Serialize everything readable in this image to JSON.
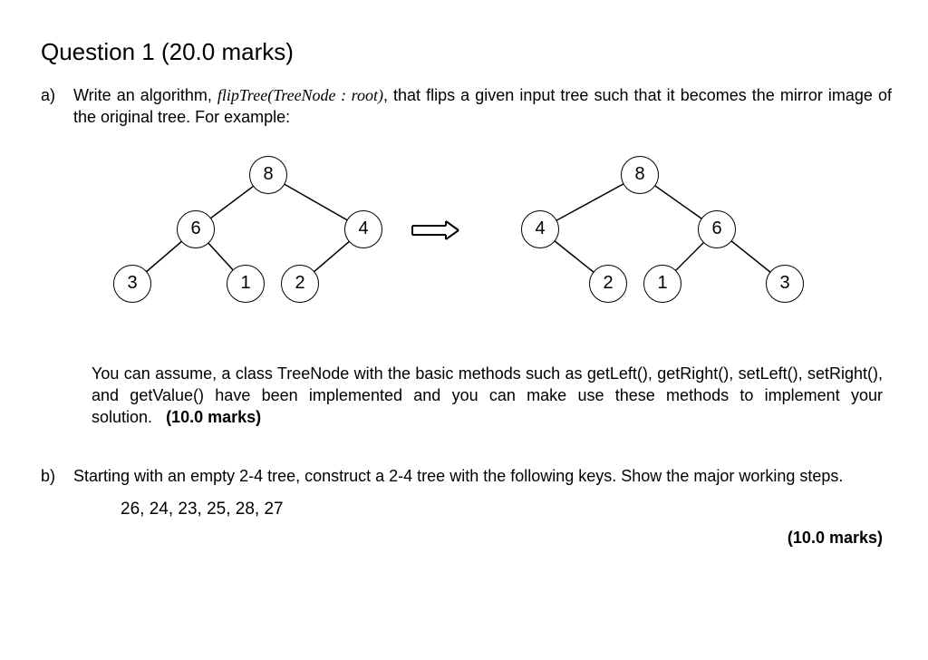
{
  "title": "Question 1 (20.0 marks)",
  "partA": {
    "letter": "a)",
    "lead": "Write an algorithm, ",
    "func": "flipTree(TreeNode : root)",
    "tail1": ", that flips a given input tree such that it becomes the mirror image of the original tree. For example:",
    "assume1": "You can assume, a class TreeNode with the basic methods such as getLeft(), getRight(), setLeft(), setRight(), and getValue() have been implemented and you can make use these methods to implement your solution.",
    "marksInline": "(10.0 marks)"
  },
  "tree_left": {
    "n8": "8",
    "n6": "6",
    "n4": "4",
    "n3": "3",
    "n1": "1",
    "n2": "2"
  },
  "tree_right": {
    "n8": "8",
    "n4": "4",
    "n6": "6",
    "n2": "2",
    "n1": "1",
    "n3": "3"
  },
  "partB": {
    "letter": "b)",
    "text": "Starting with an empty 2-4 tree, construct a 2-4 tree with the following keys. Show the major working steps.",
    "keys": "26, 24, 23, 25, 28, 27",
    "marks": "(10.0 marks)"
  },
  "chart_data": [
    {
      "type": "tree",
      "title": "original",
      "nodes": [
        {
          "id": "8",
          "children": [
            "6",
            "4"
          ]
        },
        {
          "id": "6",
          "children": [
            "3",
            "1"
          ]
        },
        {
          "id": "4",
          "children": [
            "2",
            null
          ]
        },
        {
          "id": "3"
        },
        {
          "id": "1"
        },
        {
          "id": "2"
        }
      ]
    },
    {
      "type": "tree",
      "title": "mirrored",
      "nodes": [
        {
          "id": "8",
          "children": [
            "4",
            "6"
          ]
        },
        {
          "id": "4",
          "children": [
            null,
            "2"
          ]
        },
        {
          "id": "6",
          "children": [
            "1",
            "3"
          ]
        },
        {
          "id": "2"
        },
        {
          "id": "1"
        },
        {
          "id": "3"
        }
      ]
    }
  ]
}
